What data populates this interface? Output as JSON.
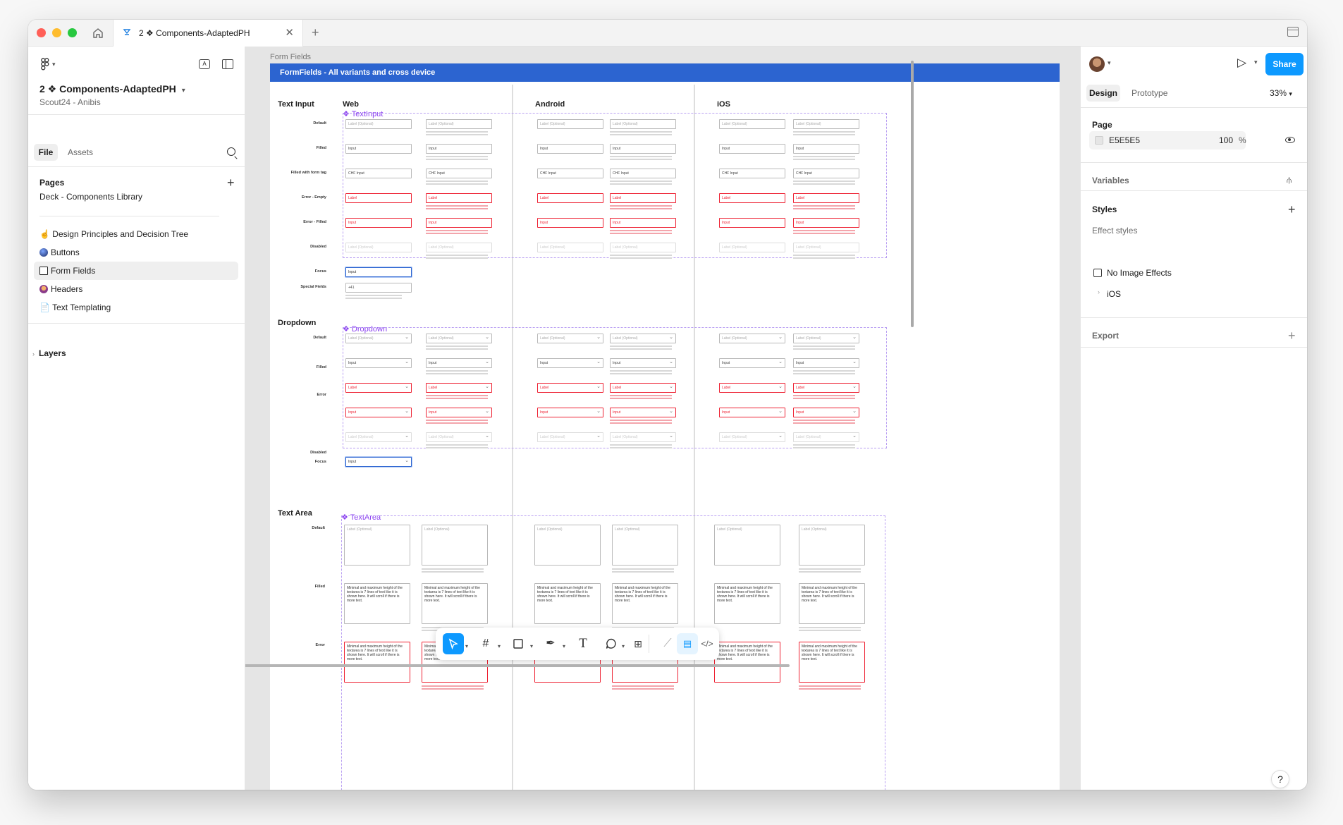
{
  "window": {
    "tab_title": "2 ❖ Components-AdaptedPH",
    "new_tab_symbol": "+",
    "close_symbol": "✕"
  },
  "left_panel": {
    "file_name": "2 ❖ Components-AdaptedPH",
    "team": "Scout24 - Anibis",
    "tabs": [
      "File",
      "Assets"
    ],
    "pages_heading": "Pages",
    "pages": [
      {
        "label": "Deck - Components Library",
        "emoji": ""
      },
      {
        "label": "Design Principles and Decision Tree",
        "emoji": "☝️"
      },
      {
        "label": "Buttons",
        "emoji": "🔵"
      },
      {
        "label": "Form Fields",
        "emoji": "🔲",
        "selected": true
      },
      {
        "label": "Headers",
        "emoji": "🧕"
      },
      {
        "label": "Text Templating",
        "emoji": "📄"
      }
    ],
    "layers_heading": "Layers"
  },
  "right_panel": {
    "share_label": "Share",
    "tabs": [
      "Design",
      "Prototype"
    ],
    "zoom": "33%",
    "page_heading": "Page",
    "page_color_hex": "E5E5E5",
    "page_opacity": "100",
    "page_opacity_unit": "%",
    "variables_heading": "Variables",
    "styles_heading": "Styles",
    "effect_styles_heading": "Effect styles",
    "effect_items": [
      "No Image Effects",
      "iOS"
    ],
    "export_heading": "Export",
    "help_label": "?"
  },
  "canvas": {
    "frame_label": "Form Fields",
    "frame_title": "FormFields - All variants and cross device",
    "platforms": [
      "Web",
      "Android",
      "iOS"
    ],
    "sections": {
      "text_input": {
        "title": "Text Input",
        "component": "❖ TextInput",
        "rows": [
          "Default",
          "Filled",
          "Filled with form tag",
          "Error - Empty",
          "Error - Filled",
          "Disabled",
          "Focus",
          "Special Fields"
        ]
      },
      "dropdown": {
        "title": "Dropdown",
        "component": "❖ Dropdown",
        "rows": [
          "Default",
          "Filled",
          "Error",
          "Disabled",
          "Focus"
        ]
      },
      "text_area": {
        "title": "Text Area",
        "component": "❖ TextArea",
        "rows": [
          "Default",
          "Filled",
          "Error"
        ]
      }
    },
    "field_texts": {
      "placeholder": "Label (Optional)",
      "input": "Input",
      "label": "Label",
      "tag_input": "CHF  Input",
      "phone": "+41",
      "textarea_filled": "Minimal and maximum height of the textarea is 7 lines of text like it is shown here. It will scroll if there is more text."
    }
  },
  "toolbar": {
    "tools": [
      "move-tool",
      "frame-tool",
      "shape-tool",
      "pen-tool",
      "text-tool",
      "comment-tool",
      "actions-tool",
      "draw-tool",
      "design-mode",
      "dev-mode"
    ]
  },
  "colors": {
    "accent": "#0D99FF",
    "frame_header": "#2C64D0",
    "component_purple": "#8A3FF0",
    "error": "#E22233",
    "canvas_bg": "#E5E5E5"
  }
}
